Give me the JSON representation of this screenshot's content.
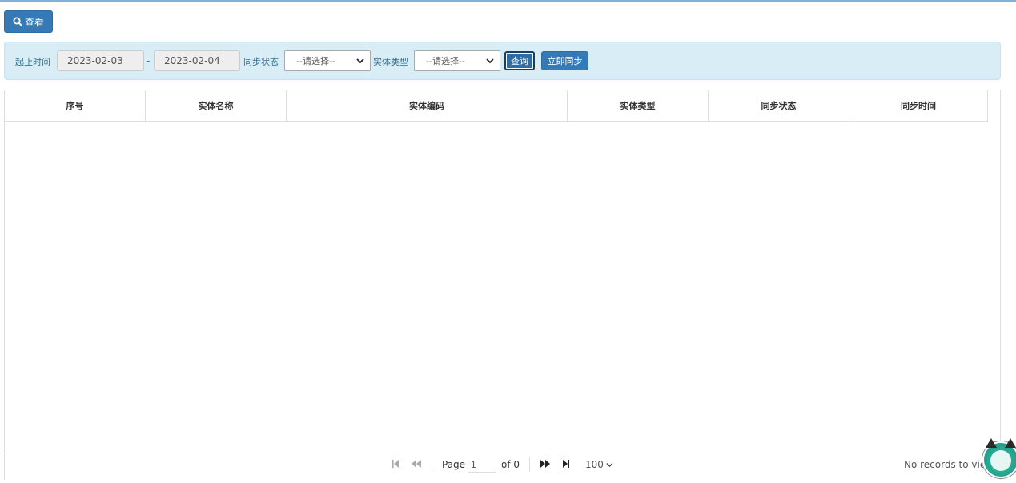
{
  "toolbar": {
    "view_label": "查看"
  },
  "filters": {
    "time_label": "起止时间",
    "start_date": "2023-02-03",
    "separator": "-",
    "end_date": "2023-02-04",
    "sync_status_label": "同步状态",
    "sync_status_value": "--请选择--",
    "entity_type_label": "实体类型",
    "entity_type_value": "--请选择--",
    "query_label": "查询",
    "sync_now_label": "立即同步"
  },
  "table": {
    "columns": [
      "序号",
      "实体名称",
      "实体编码",
      "实体类型",
      "同步状态",
      "同步时间"
    ],
    "rows": []
  },
  "pager": {
    "page_label": "Page",
    "page_value": "1",
    "of_label": "of 0",
    "page_size": "100",
    "records_text": "No records to view"
  },
  "colors": {
    "primary": "#337ab7",
    "filter_bg": "#d9edf7",
    "mascot": "#1a8f7d"
  }
}
